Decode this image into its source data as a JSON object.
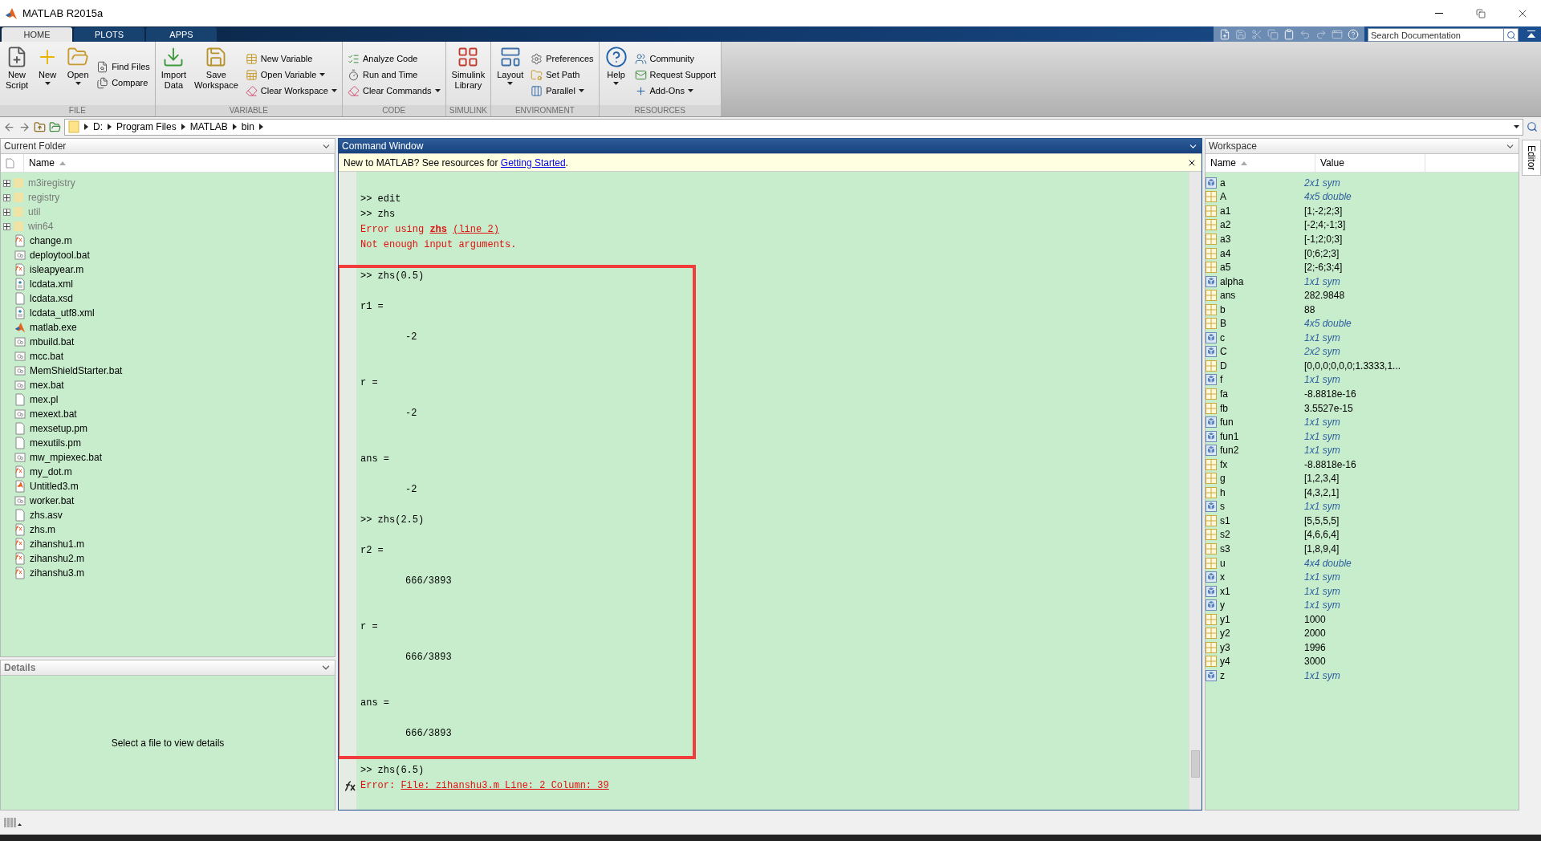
{
  "window": {
    "title": "MATLAB R2015a"
  },
  "tabs": [
    {
      "label": "HOME",
      "selected": true
    },
    {
      "label": "PLOTS",
      "selected": false
    },
    {
      "label": "APPS",
      "selected": false
    }
  ],
  "search": {
    "placeholder": "Search Documentation"
  },
  "toolstrip": [
    {
      "label": "FILE",
      "items": [
        {
          "label": "New Script",
          "kind": "large",
          "dropdown": false
        },
        {
          "label": "New",
          "kind": "large",
          "dropdown": true
        },
        {
          "label": "Open",
          "kind": "large",
          "dropdown": true
        },
        {
          "label": "Find Files",
          "kind": "small",
          "dropdown": false
        },
        {
          "label": "Compare",
          "kind": "small",
          "dropdown": false
        }
      ]
    },
    {
      "label": "VARIABLE",
      "items": [
        {
          "label": "Import Data",
          "kind": "large",
          "dropdown": false
        },
        {
          "label": "Save Workspace",
          "kind": "large",
          "dropdown": false
        },
        {
          "label": "New Variable",
          "kind": "small",
          "dropdown": false
        },
        {
          "label": "Open Variable",
          "kind": "small",
          "dropdown": true
        },
        {
          "label": "Clear Workspace",
          "kind": "small",
          "dropdown": true
        }
      ]
    },
    {
      "label": "CODE",
      "items": [
        {
          "label": "Analyze Code",
          "kind": "small",
          "dropdown": false
        },
        {
          "label": "Run and Time",
          "kind": "small",
          "dropdown": false
        },
        {
          "label": "Clear Commands",
          "kind": "small",
          "dropdown": true
        }
      ]
    },
    {
      "label": "SIMULINK",
      "items": [
        {
          "label": "Simulink Library",
          "kind": "large",
          "dropdown": false
        }
      ]
    },
    {
      "label": "ENVIRONMENT",
      "items": [
        {
          "label": "Layout",
          "kind": "large",
          "dropdown": true
        },
        {
          "label": "Preferences",
          "kind": "small",
          "dropdown": false
        },
        {
          "label": "Set Path",
          "kind": "small",
          "dropdown": false
        },
        {
          "label": "Parallel",
          "kind": "small",
          "dropdown": true
        }
      ]
    },
    {
      "label": "RESOURCES",
      "items": [
        {
          "label": "Help",
          "kind": "large",
          "dropdown": true
        },
        {
          "label": "Community",
          "kind": "small",
          "dropdown": false
        },
        {
          "label": "Request Support",
          "kind": "small",
          "dropdown": false
        },
        {
          "label": "Add-Ons",
          "kind": "small",
          "dropdown": true
        }
      ]
    }
  ],
  "address": {
    "segments": [
      "D:",
      "Program Files",
      "MATLAB",
      "bin"
    ]
  },
  "current_folder": {
    "title": "Current Folder",
    "column": "Name",
    "items": [
      {
        "name": "m3iregistry",
        "kind": "folder"
      },
      {
        "name": "registry",
        "kind": "folder"
      },
      {
        "name": "util",
        "kind": "folder"
      },
      {
        "name": "win64",
        "kind": "folder"
      },
      {
        "name": "change.m",
        "kind": "function"
      },
      {
        "name": "deploytool.bat",
        "kind": "batch"
      },
      {
        "name": "isleapyear.m",
        "kind": "function"
      },
      {
        "name": "lcdata.xml",
        "kind": "xml"
      },
      {
        "name": "lcdata.xsd",
        "kind": "file"
      },
      {
        "name": "lcdata_utf8.xml",
        "kind": "xml"
      },
      {
        "name": "matlab.exe",
        "kind": "exe"
      },
      {
        "name": "mbuild.bat",
        "kind": "batch"
      },
      {
        "name": "mcc.bat",
        "kind": "batch"
      },
      {
        "name": "MemShieldStarter.bat",
        "kind": "batch"
      },
      {
        "name": "mex.bat",
        "kind": "batch"
      },
      {
        "name": "mex.pl",
        "kind": "file"
      },
      {
        "name": "mexext.bat",
        "kind": "batch"
      },
      {
        "name": "mexsetup.pm",
        "kind": "file"
      },
      {
        "name": "mexutils.pm",
        "kind": "file"
      },
      {
        "name": "mw_mpiexec.bat",
        "kind": "batch"
      },
      {
        "name": "my_dot.m",
        "kind": "function"
      },
      {
        "name": "Untitled3.m",
        "kind": "script"
      },
      {
        "name": "worker.bat",
        "kind": "batch"
      },
      {
        "name": "zhs.asv",
        "kind": "file"
      },
      {
        "name": "zhs.m",
        "kind": "function"
      },
      {
        "name": "zihanshu1.m",
        "kind": "function"
      },
      {
        "name": "zihanshu2.m",
        "kind": "function"
      },
      {
        "name": "zihanshu3.m",
        "kind": "function"
      }
    ]
  },
  "details": {
    "title": "Details",
    "message": "Select a file to view details"
  },
  "command_window": {
    "title": "Command Window",
    "notice": {
      "text": "New to MATLAB? See resources for ",
      "link": "Getting Started",
      "end": "."
    },
    "blocks": [
      {
        "annotated": false,
        "lines": [
          {
            "kind": "prompt",
            "text": ">> edit"
          },
          {
            "kind": "prompt",
            "text": ">> zhs"
          },
          {
            "kind": "error",
            "segments": [
              {
                "text": "Error using ",
                "link": false,
                "bold": false
              },
              {
                "text": "zhs",
                "link": true,
                "bold": true
              },
              {
                "text": "(line 2)",
                "link": true,
                "bold": false
              }
            ]
          },
          {
            "kind": "error",
            "segments": [
              {
                "text": "Not enough input arguments.",
                "link": false,
                "bold": false
              }
            ]
          }
        ]
      },
      {
        "annotated": true,
        "lines": [
          {
            "kind": "prompt",
            "text": ">> zhs(0.5)"
          },
          {
            "kind": "label",
            "text": "r1 ="
          },
          {
            "kind": "value",
            "text": "-2"
          },
          {
            "kind": "label",
            "text": "r ="
          },
          {
            "kind": "value",
            "text": "-2"
          },
          {
            "kind": "label",
            "text": "ans ="
          },
          {
            "kind": "value",
            "text": "-2"
          },
          {
            "kind": "prompt",
            "text": ">> zhs(2.5)"
          },
          {
            "kind": "label",
            "text": "r2 ="
          },
          {
            "kind": "value",
            "text": "666/3893"
          },
          {
            "kind": "label",
            "text": "r ="
          },
          {
            "kind": "value",
            "text": "666/3893"
          },
          {
            "kind": "label",
            "text": "ans ="
          },
          {
            "kind": "value",
            "text": "666/3893"
          }
        ]
      },
      {
        "annotated": false,
        "lines": [
          {
            "kind": "prompt",
            "text": ">> zhs(6.5)"
          },
          {
            "kind": "error",
            "segments": [
              {
                "text": "Error: ",
                "link": false,
                "bold": false
              },
              {
                "text": "File: zihanshu3.m Line: 2 Column: 39",
                "link": true,
                "bold": false
              }
            ]
          }
        ]
      }
    ]
  },
  "workspace": {
    "title": "Workspace",
    "columns": [
      "Name",
      "Value"
    ],
    "rows": [
      {
        "name": "a",
        "value": "2x1 sym",
        "kind": "sym"
      },
      {
        "name": "A",
        "value": "4x5 double",
        "kind": "array"
      },
      {
        "name": "a1",
        "value": "[1;-2;2;3]",
        "kind": "value"
      },
      {
        "name": "a2",
        "value": "[-2;4;-1;3]",
        "kind": "value"
      },
      {
        "name": "a3",
        "value": "[-1;2;0;3]",
        "kind": "value"
      },
      {
        "name": "a4",
        "value": "[0;6;2;3]",
        "kind": "value"
      },
      {
        "name": "a5",
        "value": "[2;-6;3;4]",
        "kind": "value"
      },
      {
        "name": "alpha",
        "value": "1x1 sym",
        "kind": "sym"
      },
      {
        "name": "ans",
        "value": "282.9848",
        "kind": "value"
      },
      {
        "name": "b",
        "value": "88",
        "kind": "value"
      },
      {
        "name": "B",
        "value": "4x5 double",
        "kind": "array"
      },
      {
        "name": "c",
        "value": "1x1 sym",
        "kind": "sym"
      },
      {
        "name": "C",
        "value": "2x2 sym",
        "kind": "sym"
      },
      {
        "name": "D",
        "value": "[0,0,0;0,0,0;1.3333,1...",
        "kind": "value"
      },
      {
        "name": "f",
        "value": "1x1 sym",
        "kind": "sym"
      },
      {
        "name": "fa",
        "value": "-8.8818e-16",
        "kind": "value"
      },
      {
        "name": "fb",
        "value": "3.5527e-15",
        "kind": "value"
      },
      {
        "name": "fun",
        "value": "1x1 sym",
        "kind": "sym"
      },
      {
        "name": "fun1",
        "value": "1x1 sym",
        "kind": "sym"
      },
      {
        "name": "fun2",
        "value": "1x1 sym",
        "kind": "sym"
      },
      {
        "name": "fx",
        "value": "-8.8818e-16",
        "kind": "value"
      },
      {
        "name": "g",
        "value": "[1,2,3,4]",
        "kind": "value"
      },
      {
        "name": "h",
        "value": "[4,3,2,1]",
        "kind": "value"
      },
      {
        "name": "s",
        "value": "1x1 sym",
        "kind": "sym"
      },
      {
        "name": "s1",
        "value": "[5,5,5,5]",
        "kind": "value"
      },
      {
        "name": "s2",
        "value": "[4,6,6,4]",
        "kind": "value"
      },
      {
        "name": "s3",
        "value": "[1,8,9,4]",
        "kind": "value"
      },
      {
        "name": "u",
        "value": "4x4 double",
        "kind": "array"
      },
      {
        "name": "x",
        "value": "1x1 sym",
        "kind": "sym"
      },
      {
        "name": "x1",
        "value": "1x1 sym",
        "kind": "sym"
      },
      {
        "name": "y",
        "value": "1x1 sym",
        "kind": "sym"
      },
      {
        "name": "y1",
        "value": "1000",
        "kind": "value"
      },
      {
        "name": "y2",
        "value": "2000",
        "kind": "value"
      },
      {
        "name": "y3",
        "value": "1996",
        "kind": "value"
      },
      {
        "name": "y4",
        "value": "3000",
        "kind": "value"
      },
      {
        "name": "z",
        "value": "1x1 sym",
        "kind": "sym"
      }
    ]
  },
  "side_tab": {
    "label": "Editor"
  }
}
